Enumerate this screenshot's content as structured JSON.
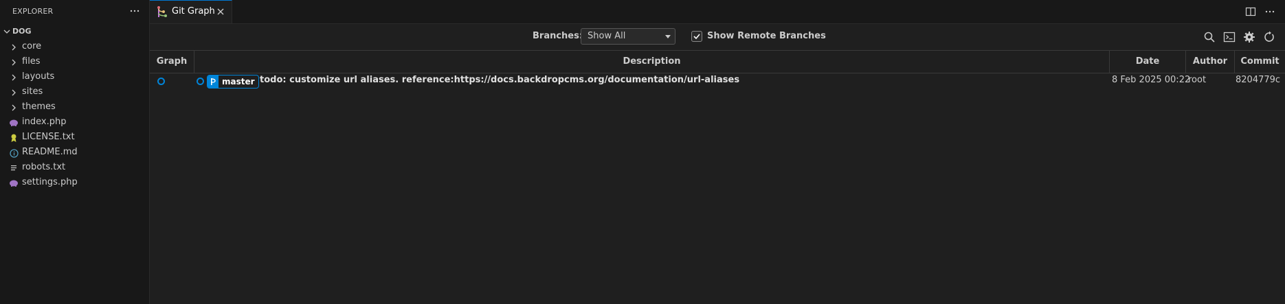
{
  "sidebar": {
    "title": "EXPLORER",
    "root": "DOG",
    "items": [
      {
        "label": "core",
        "icon": "chevron-right-icon"
      },
      {
        "label": "files",
        "icon": "chevron-right-icon"
      },
      {
        "label": "layouts",
        "icon": "chevron-right-icon"
      },
      {
        "label": "sites",
        "icon": "chevron-right-icon"
      },
      {
        "label": "themes",
        "icon": "chevron-right-icon"
      },
      {
        "label": "index.php",
        "icon": "php-elephant-icon"
      },
      {
        "label": "LICENSE.txt",
        "icon": "license-icon"
      },
      {
        "label": "README.md",
        "icon": "info-icon"
      },
      {
        "label": "robots.txt",
        "icon": "text-lines-icon"
      },
      {
        "label": "settings.php",
        "icon": "php-elephant-icon"
      }
    ]
  },
  "tab": {
    "label": "Git Graph"
  },
  "controls": {
    "branches_label": "Branches:",
    "branches_value": "Show All",
    "remote_label": "Show Remote Branches",
    "remote_checked": true
  },
  "table": {
    "headers": {
      "graph": "Graph",
      "description": "Description",
      "date": "Date",
      "author": "Author",
      "commit": "Commit"
    },
    "rows": [
      {
        "branch": "master",
        "description": "todo: customize url aliases. reference:https://docs.backdropcms.org/documentation/url-aliases",
        "date": "8 Feb 2025 00:22",
        "author": "root",
        "commit": "8204779c"
      }
    ]
  },
  "colors": {
    "accent": "#0085d9",
    "background": "#1f1f1f",
    "sidebar": "#181818"
  }
}
